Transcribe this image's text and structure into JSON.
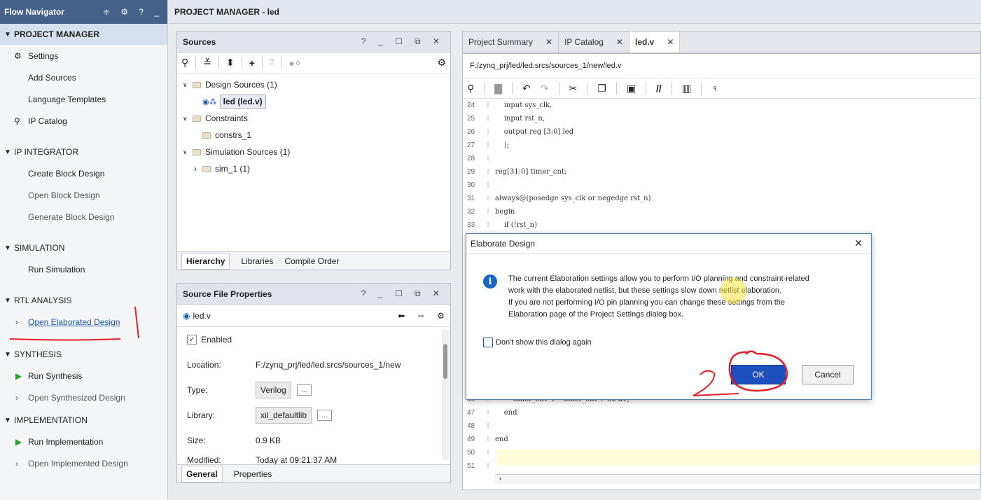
{
  "flow_nav": {
    "title": "Flow Navigator",
    "controls": "≑ ⚙ ? _",
    "pm": "PROJECT MANAGER",
    "settings": "Settings",
    "add_sources": "Add Sources",
    "lang_templates": "Language Templates",
    "ip_catalog": "IP Catalog",
    "ipi": "IP INTEGRATOR",
    "create_bd": "Create Block Design",
    "open_bd": "Open Block Design",
    "gen_bd": "Generate Block Design",
    "sim": "SIMULATION",
    "run_sim": "Run Simulation",
    "rtl": "RTL ANALYSIS",
    "open_elab": "Open Elaborated Design",
    "synth": "SYNTHESIS",
    "run_synth": "Run Synthesis",
    "open_synth": "Open Synthesized Design",
    "impl": "IMPLEMENTATION",
    "run_impl": "Run Implementation",
    "open_impl": "Open Implemented Design"
  },
  "topbar": {
    "title": "PROJECT MANAGER - led"
  },
  "sources": {
    "title": "Sources",
    "controls": "? _ ☐ ⧉ ✕",
    "count": "0",
    "design_sources": "Design Sources (1)",
    "led": "led (led.v)",
    "constraints": "Constraints",
    "constrs": "constrs_1",
    "sim_sources": "Simulation Sources (1)",
    "sim1": "sim_1 (1)",
    "tabs": [
      "Hierarchy",
      "Libraries",
      "Compile Order"
    ]
  },
  "props": {
    "title": "Source File Properties",
    "controls": "? _ ☐ ⧉ ✕",
    "file": "led.v",
    "enabled": "Enabled",
    "location_k": "Location:",
    "location_v": "F:/zynq_prj/led/led.srcs/sources_1/new",
    "type_k": "Type:",
    "type_v": "Verilog",
    "library_k": "Library:",
    "library_v": "xil_defaultlib",
    "size_k": "Size:",
    "size_v": "0.9 KB",
    "modified_k": "Modified:",
    "modified_v": "Today at 09:21:37 AM",
    "tabs": [
      "General",
      "Properties"
    ]
  },
  "editor": {
    "tabs": [
      "Project Summary",
      "IP Catalog",
      "led.v"
    ],
    "path": "F:/zynq_prj/led/led.srcs/sources_1/new/led.v",
    "lines": [
      {
        "n": "24",
        "code": "    input sys_clk,"
      },
      {
        "n": "25",
        "code": "    input rst_n,"
      },
      {
        "n": "26",
        "code": "    output reg [3:0] led"
      },
      {
        "n": "27",
        "code": "    );"
      },
      {
        "n": "28",
        "code": ""
      },
      {
        "n": "29",
        "code": "reg[31:0] timer_cnt;"
      },
      {
        "n": "30",
        "code": ""
      },
      {
        "n": "31",
        "code": "always@(posedge sys_clk or negedge rst_n)"
      },
      {
        "n": "32",
        "code": "begin"
      },
      {
        "n": "33",
        "code": "    if (!rst_n)"
      },
      {
        "n": "46",
        "code": "        timer_cnt <= timer_cnt + 32'd1;"
      },
      {
        "n": "47",
        "code": "    end"
      },
      {
        "n": "48",
        "code": ""
      },
      {
        "n": "49",
        "code": "end"
      },
      {
        "n": "50",
        "code": ""
      },
      {
        "n": "51",
        "code": ""
      }
    ]
  },
  "dialog": {
    "title": "Elaborate Design",
    "close": "✕",
    "msg1": "The current Elaboration settings allow you to perform I/O planning and constraint-related",
    "msg2": "work with the elaborated netlist, but these settings slow down netlist elaboration.",
    "msg3": "If you are not performing I/O pin planning you can change these settings from the",
    "msg4": "Elaboration page of the Project Settings dialog box.",
    "dont_show": "Don't show this dialog again",
    "ok": "OK",
    "cancel": "Cancel"
  },
  "annotations": {
    "mark1": "1",
    "mark2": "2",
    "color": "#e0202a"
  }
}
